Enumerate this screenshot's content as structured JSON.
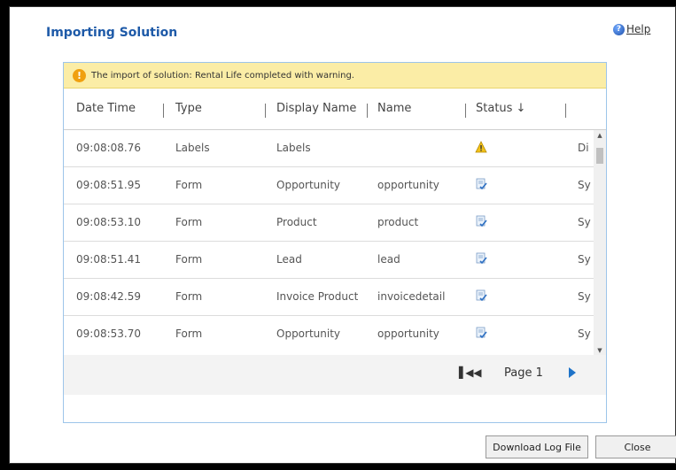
{
  "dialog": {
    "title": "Importing Solution",
    "help_label": "Help",
    "help_icon": "help-icon"
  },
  "warning": {
    "icon": "warning-icon",
    "message": "The import of solution: Rental Life completed with warning."
  },
  "grid": {
    "columns": [
      "Date Time",
      "Type",
      "Display Name",
      "Name",
      "Status ↓"
    ],
    "rows": [
      {
        "time": "09:08:08.76",
        "type": "Labels",
        "display": "Labels",
        "name": "",
        "status": "warning-icon",
        "extra": "Di"
      },
      {
        "time": "09:08:51.95",
        "type": "Form",
        "display": "Opportunity",
        "name": "opportunity",
        "status": "document-check-icon",
        "extra": "Sy"
      },
      {
        "time": "09:08:53.10",
        "type": "Form",
        "display": "Product",
        "name": "product",
        "status": "document-check-icon",
        "extra": "Sy"
      },
      {
        "time": "09:08:51.41",
        "type": "Form",
        "display": "Lead",
        "name": "lead",
        "status": "document-check-icon",
        "extra": "Sy"
      },
      {
        "time": "09:08:42.59",
        "type": "Form",
        "display": "Invoice Product",
        "name": "invoicedetail",
        "status": "document-check-icon",
        "extra": "Sy"
      },
      {
        "time": "09:08:53.70",
        "type": "Form",
        "display": "Opportunity",
        "name": "opportunity",
        "status": "document-check-icon",
        "extra": "Sy"
      }
    ]
  },
  "pager": {
    "page_label": "Page 1"
  },
  "buttons": {
    "download": "Download Log File",
    "close": "Close"
  },
  "colors": {
    "title": "#1e5aa8",
    "warning_bar": "#fbeda6",
    "panel_border": "#9dc5ea",
    "next_arrow": "#1e73c8"
  }
}
